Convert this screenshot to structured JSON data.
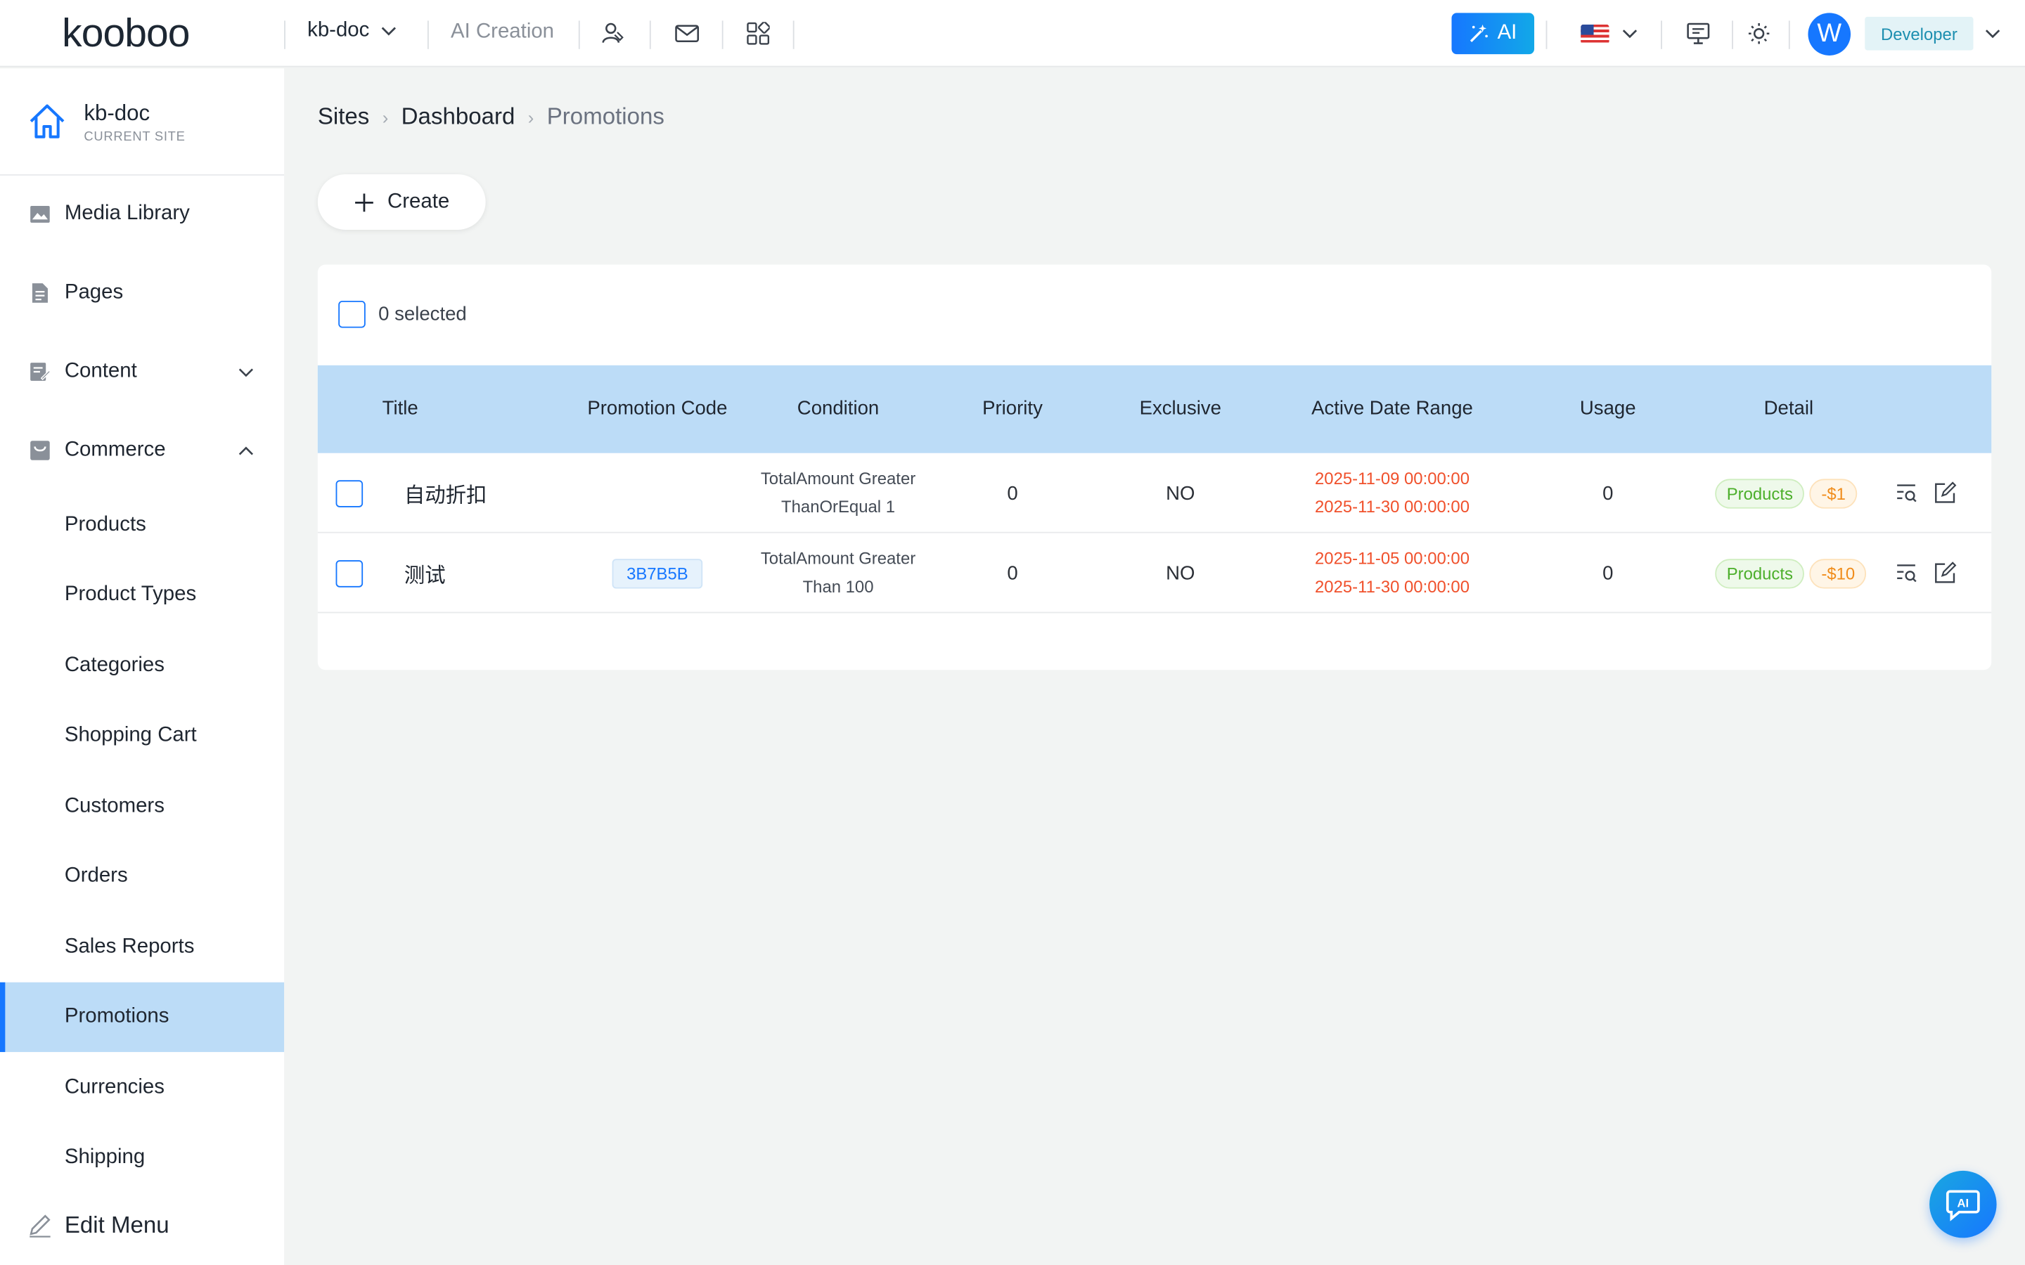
{
  "header": {
    "logo": "kooboo",
    "site_switch": "kb-doc",
    "ai_creation": "AI Creation",
    "ai_button": "AI",
    "avatar_letter": "W",
    "role": "Developer"
  },
  "sidebar": {
    "current_site_name": "kb-doc",
    "current_site_label": "CURRENT SITE",
    "items": [
      {
        "label": "Media Library"
      },
      {
        "label": "Pages"
      },
      {
        "label": "Content"
      },
      {
        "label": "Commerce"
      },
      {
        "label": "Products"
      },
      {
        "label": "Product Types"
      },
      {
        "label": "Categories"
      },
      {
        "label": "Shopping Cart"
      },
      {
        "label": "Customers"
      },
      {
        "label": "Orders"
      },
      {
        "label": "Sales Reports"
      },
      {
        "label": "Promotions"
      },
      {
        "label": "Currencies"
      },
      {
        "label": "Shipping"
      }
    ],
    "edit_menu": "Edit Menu"
  },
  "breadcrumb": {
    "items": [
      "Sites",
      "Dashboard",
      "Promotions"
    ]
  },
  "toolbar": {
    "create_label": "Create"
  },
  "table": {
    "selected_text": "0 selected",
    "columns": [
      "Title",
      "Promotion Code",
      "Condition",
      "Priority",
      "Exclusive",
      "Active Date Range",
      "Usage",
      "Detail"
    ],
    "rows": [
      {
        "title": "自动折扣",
        "code": "",
        "condition": "TotalAmount GreaterThanOrEqual 1",
        "priority": "0",
        "exclusive": "NO",
        "date_start": "2025-11-09 00:00:00",
        "date_end": "2025-11-30 00:00:00",
        "usage": "0",
        "detail_tag": "Products",
        "discount": "-$1"
      },
      {
        "title": "测试",
        "code": "3B7B5B",
        "condition": "TotalAmount GreaterThan 100",
        "priority": "0",
        "exclusive": "NO",
        "date_start": "2025-11-05 00:00:00",
        "date_end": "2025-11-30 00:00:00",
        "usage": "0",
        "detail_tag": "Products",
        "discount": "-$10"
      }
    ]
  },
  "fab": {
    "label": "AI"
  },
  "colors": {
    "accent": "#1677ff",
    "header_row": "#bcdcf7",
    "date_red": "#f0502b",
    "tag_green": "#4caf2b",
    "tag_orange": "#f08c1a"
  }
}
